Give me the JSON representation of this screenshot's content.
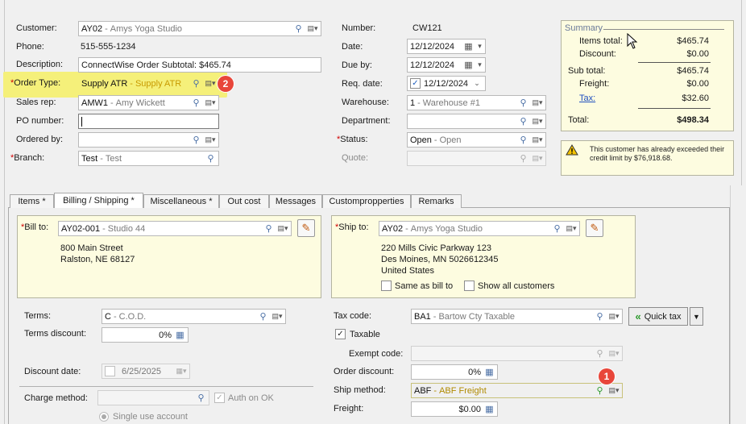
{
  "header": {
    "customer_label": "Customer:",
    "customer_code": "AY02",
    "customer_name": "Amys Yoga Studio",
    "phone_label": "Phone:",
    "phone": "515-555-1234",
    "description_label": "Description:",
    "description": "ConnectWise Order Subtotal: $465.74",
    "order_type_label": "Order Type:",
    "order_type_code": "Supply ATR",
    "order_type_name": "Supply ATR",
    "sales_rep_label": "Sales rep:",
    "sales_rep_code": "AMW1",
    "sales_rep_name": "Amy Wickett",
    "po_label": "PO number:",
    "po_value": "",
    "ordered_by_label": "Ordered by:",
    "ordered_by_value": "",
    "branch_label": "Branch:",
    "branch_code": "Test",
    "branch_name": "Test",
    "number_label": "Number:",
    "number": "CW121",
    "date_label": "Date:",
    "date": "12/12/2024",
    "due_label": "Due by:",
    "due": "12/12/2024",
    "req_label": "Req. date:",
    "req": "12/12/2024",
    "warehouse_label": "Warehouse:",
    "warehouse_code": "1",
    "warehouse_name": "Warehouse #1",
    "department_label": "Department:",
    "status_label": "Status:",
    "status_code": "Open",
    "status_name": "Open",
    "quote_label": "Quote:",
    "required_mark": "*"
  },
  "summary": {
    "title": "Summary",
    "items_total_label": "Items total:",
    "items_total": "$465.74",
    "discount_label": "Discount:",
    "discount": "$0.00",
    "sub_total_label": "Sub total:",
    "sub_total": "$465.74",
    "freight_label": "Freight:",
    "freight": "$0.00",
    "tax_label": "Tax:",
    "tax": "$32.60",
    "total_label": "Total:",
    "total": "$498.34"
  },
  "warning": {
    "text": "This customer has already exceeded their credit limit by $76,918.68."
  },
  "tabs": [
    {
      "label": "Items *"
    },
    {
      "label": "Billing / Shipping *"
    },
    {
      "label": "Miscellaneous *"
    },
    {
      "label": "Out cost"
    },
    {
      "label": "Messages"
    },
    {
      "label": "Custompropperties"
    },
    {
      "label": "Remarks"
    }
  ],
  "bill": {
    "label": "Bill to:",
    "code": "AY02-001",
    "name": "Studio 44",
    "line1": "800 Main Street",
    "line2": "Ralston, NE 68127"
  },
  "ship": {
    "label": "Ship to:",
    "code": "AY02",
    "name": "Amys Yoga Studio",
    "line1": "220 Mills Civic Parkway 123",
    "line2": "Des Moines, MN 5026612345",
    "line3": "United States",
    "same_as_bill": "Same as bill to",
    "show_all": "Show all customers"
  },
  "billing": {
    "terms_label": "Terms:",
    "terms_code": "C",
    "terms_name": "C.O.D.",
    "terms_discount_label": "Terms discount:",
    "terms_discount": "0%",
    "discount_date_label": "Discount date:",
    "discount_date": "6/25/2025",
    "charge_method_label": "Charge method:",
    "auth_on_ok": "Auth on OK",
    "single_use": "Single use account"
  },
  "shipping": {
    "tax_code_label": "Tax code:",
    "tax_code": "BA1",
    "tax_code_name": "Bartow Cty Taxable",
    "quick_tax": "Quick tax",
    "taxable": "Taxable",
    "exempt_label": "Exempt code:",
    "order_discount_label": "Order discount:",
    "order_discount": "0%",
    "ship_method_label": "Ship method:",
    "ship_method_code": "ABF",
    "ship_method_name": "ABF Freight",
    "freight_label": "Freight:",
    "freight": "$0.00"
  },
  "badges": {
    "one": "1",
    "two": "2"
  },
  "colors": {
    "highlight": "#f5f07a",
    "badge": "#e8463a",
    "panel": "#fdfce0",
    "required": "#d00000"
  }
}
